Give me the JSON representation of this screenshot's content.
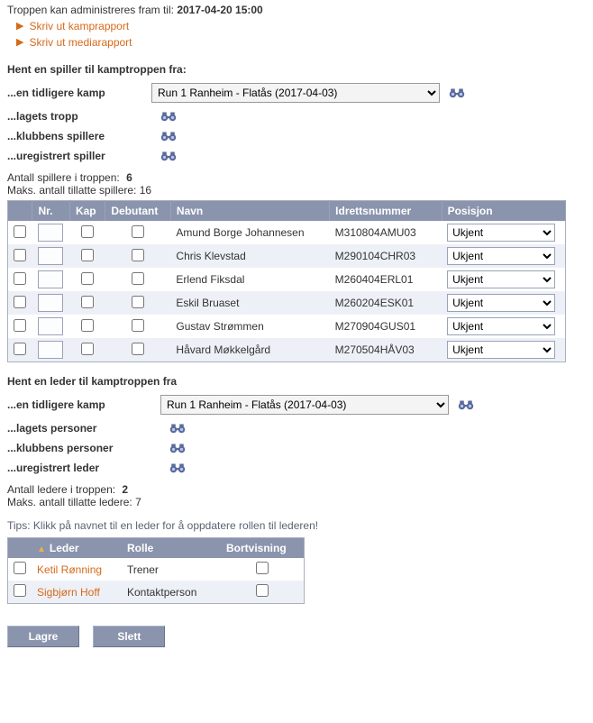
{
  "admin": {
    "prefix": "Troppen kan administreres fram til:",
    "datetime": "2017-04-20 15:00",
    "print_match_report": "Skriv ut kamprapport",
    "print_media_report": "Skriv ut mediarapport"
  },
  "player_picker": {
    "header": "Hent en spiller til kamptroppen fra:",
    "prev_match_label": "...en tidligere kamp",
    "prev_match_value": "Run 1 Ranheim - Flatås (2017-04-03)",
    "team_squad_label": "...lagets tropp",
    "club_players_label": "...klubbens spillere",
    "unregistered_label": "...uregistrert spiller"
  },
  "player_stats": {
    "count_label": "Antall spillere i troppen:",
    "count": "6",
    "max_label": "Maks. antall tillatte spillere:",
    "max": "16"
  },
  "player_table": {
    "headers": {
      "nr": "Nr.",
      "kap": "Kap",
      "debutant": "Debutant",
      "navn": "Navn",
      "idretts": "Idrettsnummer",
      "posisjon": "Posisjon"
    },
    "pos_option": "Ukjent",
    "rows": [
      {
        "navn": "Amund Borge Johannesen",
        "id": "M310804AMU03"
      },
      {
        "navn": "Chris Klevstad",
        "id": "M290104CHR03"
      },
      {
        "navn": "Erlend Fiksdal",
        "id": "M260404ERL01"
      },
      {
        "navn": "Eskil Bruaset",
        "id": "M260204ESK01"
      },
      {
        "navn": "Gustav Strømmen",
        "id": "M270904GUS01"
      },
      {
        "navn": "Håvard Møkkelgård",
        "id": "M270504HÅV03"
      }
    ]
  },
  "leader_picker": {
    "header": "Hent en leder til kamptroppen fra",
    "prev_match_label": "...en tidligere kamp",
    "prev_match_value": "Run 1 Ranheim - Flatås (2017-04-03)",
    "team_persons_label": "...lagets personer",
    "club_persons_label": "...klubbens personer",
    "unregistered_label": "...uregistrert leder"
  },
  "leader_stats": {
    "count_label": "Antall ledere i troppen:",
    "count": "2",
    "max_label": "Maks. antall tillatte ledere:",
    "max": "7"
  },
  "tip": "Tips: Klikk på navnet til en leder for å oppdatere rollen til lederen!",
  "leader_table": {
    "headers": {
      "leder": "Leder",
      "rolle": "Rolle",
      "bortvisning": "Bortvisning"
    },
    "rows": [
      {
        "name": "Ketil Rønning",
        "role": "Trener"
      },
      {
        "name": "Sigbjørn Hoff",
        "role": "Kontaktperson"
      }
    ]
  },
  "buttons": {
    "save": "Lagre",
    "delete": "Slett"
  }
}
